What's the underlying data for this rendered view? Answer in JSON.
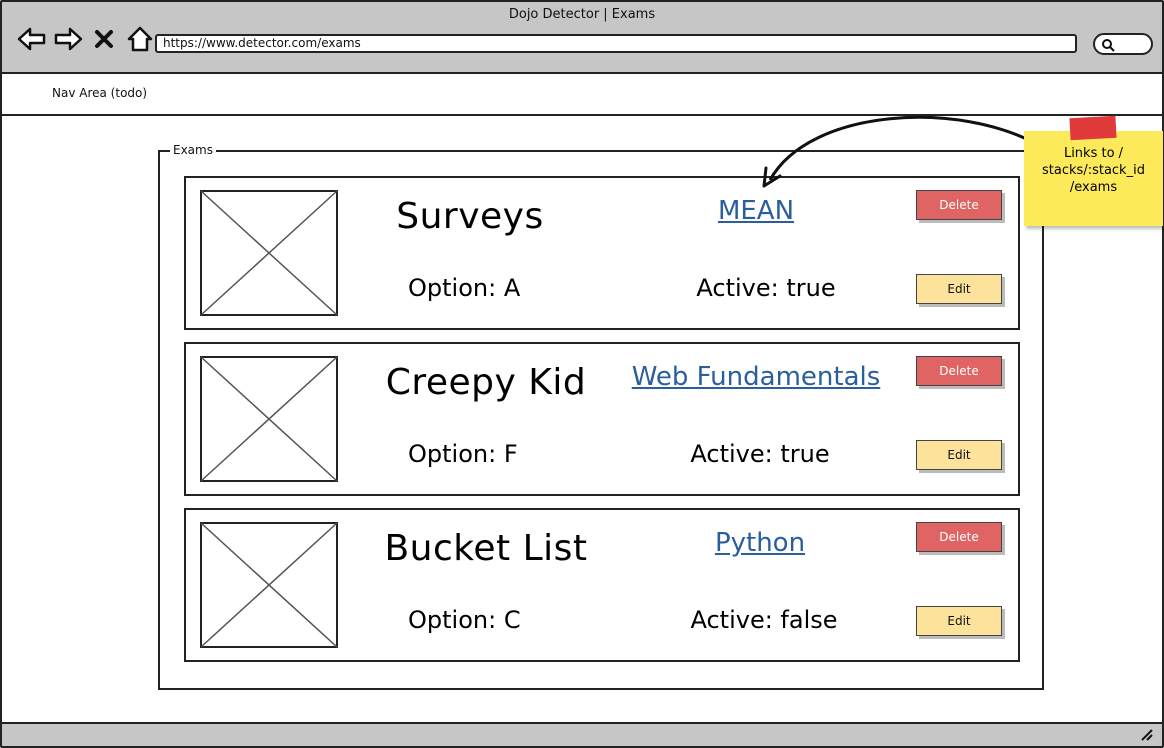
{
  "window": {
    "title": "Dojo Detector | Exams",
    "url": "https://www.detector.com/exams"
  },
  "nav": {
    "label": "Nav Area (todo)"
  },
  "exams_section": {
    "legend": "Exams",
    "items": [
      {
        "title": "Surveys",
        "stack_link": "MEAN",
        "option": "Option: A",
        "active": "Active: true",
        "delete_label": "Delete",
        "edit_label": "Edit"
      },
      {
        "title": "Creepy Kid",
        "stack_link": "Web Fundamentals",
        "option": "Option: F",
        "active": "Active: true",
        "delete_label": "Delete",
        "edit_label": "Edit"
      },
      {
        "title": "Bucket List",
        "stack_link": "Python",
        "option": "Option: C",
        "active": "Active: false",
        "delete_label": "Delete",
        "edit_label": "Edit"
      }
    ]
  },
  "sticky_note": {
    "lines": [
      "Links to /",
      "stacks/:stack_id",
      "/exams"
    ]
  },
  "icons": {
    "back": "back-arrow-icon",
    "forward": "forward-arrow-icon",
    "close": "close-icon",
    "home": "home-icon",
    "search": "search-icon",
    "resize": "resize-grip-icon"
  },
  "colors": {
    "chrome": "#c6c6c6",
    "delete": "#e06464",
    "edit": "#fde29b",
    "link": "#2a5e9c",
    "sticky": "#fdea5b",
    "tape": "#e03a3a"
  }
}
